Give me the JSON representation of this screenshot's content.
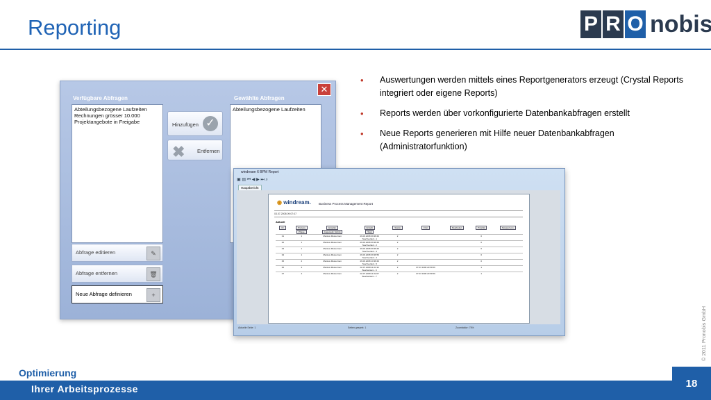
{
  "page": {
    "title": "Reporting",
    "logo_left": [
      "P",
      "R",
      "O"
    ],
    "logo_word": "nobis",
    "copyright": "© 2011 Pronobis GmbH",
    "footer_line1": "Optimierung",
    "footer_line2": "Ihrer Arbeitsprozesse",
    "page_number": "18"
  },
  "bullets": [
    "Auswertungen werden mittels eines Reportgenerators erzeugt (Crystal Reports integriert oder eigene Reports)",
    "Reports werden über vorkonfigurierte Datenbankabfragen erstellt",
    "Neue Reports generieren mit Hilfe neuer Datenbankabfragen (Administratorfunktion)"
  ],
  "dialog": {
    "available_header": "Verfügbare Abfragen",
    "selected_header": "Gewählte Abfragen",
    "available_items": [
      "Abteilungsbezogene Laufzeiten",
      "Rechnungen grösser 10.000",
      "Projektangebote in Freigabe"
    ],
    "selected_items": [
      "Abteilungsbezogene Laufzeiten"
    ],
    "add_label": "Hinzufügen",
    "remove_label": "Entfernen",
    "edit_label": "Abfrage editieren",
    "delete_label": "Abfrage entfernen",
    "define_label": "Neue Abfrage definieren"
  },
  "report_window": {
    "title": "windream 6 BPM Report",
    "tab": "Hauptbericht",
    "logo_text": "win",
    "logo_text2": "dream.",
    "report_title": "Business Process Management Report",
    "date": "03.07.2008    09:07:07",
    "section": "Aktuell",
    "columns": [
      "Nr.",
      "Prozess",
      "Ersteller",
      "Erstellt",
      "Status",
      "Frist",
      "Bearbeiter",
      "Priorität",
      "Stopped von"
    ],
    "subcolumns": [
      "Phase",
      "Angemeld. Schritt",
      "Task"
    ],
    "rows": [
      [
        "01",
        "1",
        "Mankus Musterman",
        "26.06.2008 09:38:40",
        "2",
        "",
        "",
        "0",
        ""
      ],
      [
        "02",
        "1",
        "Mankus Musterman",
        "26.06.2008 09:38:46",
        "2",
        "",
        "",
        "0",
        ""
      ],
      [
        "03",
        "1",
        "Mankus Musterman",
        "26.06.2008 09:38:46",
        "2",
        "",
        "",
        "0",
        ""
      ],
      [
        "04",
        "1",
        "Mankus Musterman",
        "26.06.2008 09:38:50",
        "2",
        "",
        "",
        "0",
        ""
      ],
      [
        "05",
        "2",
        "Mankus Musterman",
        "26.06.2008 10:38:46",
        "2",
        "",
        "",
        "0",
        ""
      ],
      [
        "06",
        "4",
        "Mankus Musterman",
        "02.07.2008 11:01:32",
        "2",
        "07.07.2008 23:59:59",
        "",
        "1",
        ""
      ],
      [
        "07",
        "4",
        "Mankus Musterman",
        "02.07.2008 11:02:07",
        "2",
        "07.07.2008 23:59:59",
        "",
        "1",
        ""
      ]
    ],
    "subrows": [
      "Teachverlauf - 1",
      "Teachverlauf - 2",
      "Teachverlauf - 3",
      "Teachverlauf - 4",
      "Teachverlauf - 5",
      "Bearbeitsam - 6",
      "Bearbeitsam - 7"
    ],
    "status_page": "Aktuelle Seite: 1",
    "status_total": "Seiten gesamt: 1",
    "status_zoom": "Zoomfaktor: 75%"
  }
}
